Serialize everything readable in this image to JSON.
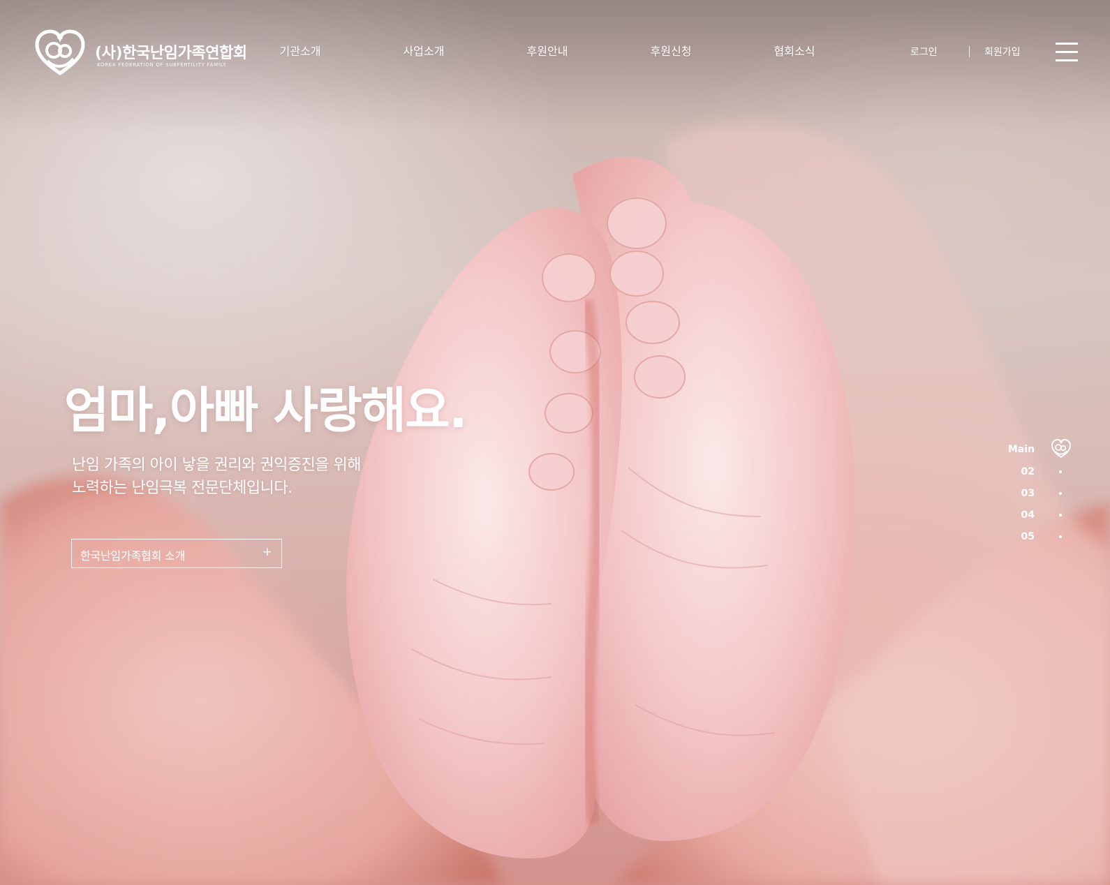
{
  "header": {
    "logo": {
      "name": "(사)한국난임가족연합회",
      "subtitle": "KOREA FEDERATION OF SUBFERTILITY FAMILY",
      "icon": "heart-family-logo-icon"
    },
    "nav": [
      {
        "label": "기관소개"
      },
      {
        "label": "사업소개"
      },
      {
        "label": "후원안내"
      },
      {
        "label": "후원신청"
      },
      {
        "label": "협회소식"
      }
    ],
    "utility": {
      "login": "로그인",
      "join": "회원가입"
    },
    "menu_icon": "hamburger-menu-icon"
  },
  "main_visual": {
    "headline": "엄마,아빠 사랑해요.",
    "description": [
      "난임 가족의 아이 낳을 권리와 권익증진을 위해",
      "노력하는 난임극복 전문단체입니다."
    ],
    "cta": {
      "label": "한국난임가족협회 소개",
      "icon": "plus-icon"
    },
    "image": "baby-feet-in-hands-photo"
  },
  "pager": {
    "items": [
      {
        "label": "Main",
        "icon": "heart-logo-icon",
        "active": true
      },
      {
        "label": "02",
        "icon": "dot-icon",
        "active": false
      },
      {
        "label": "03",
        "icon": "dot-icon",
        "active": false
      },
      {
        "label": "04",
        "icon": "dot-icon",
        "active": false
      },
      {
        "label": "05",
        "icon": "dot-icon",
        "active": false
      }
    ]
  },
  "colors": {
    "text": "#ffffff",
    "background_top": "#b7a7a2",
    "background_pink": "#efc0bf",
    "background_red": "#d4928d"
  }
}
